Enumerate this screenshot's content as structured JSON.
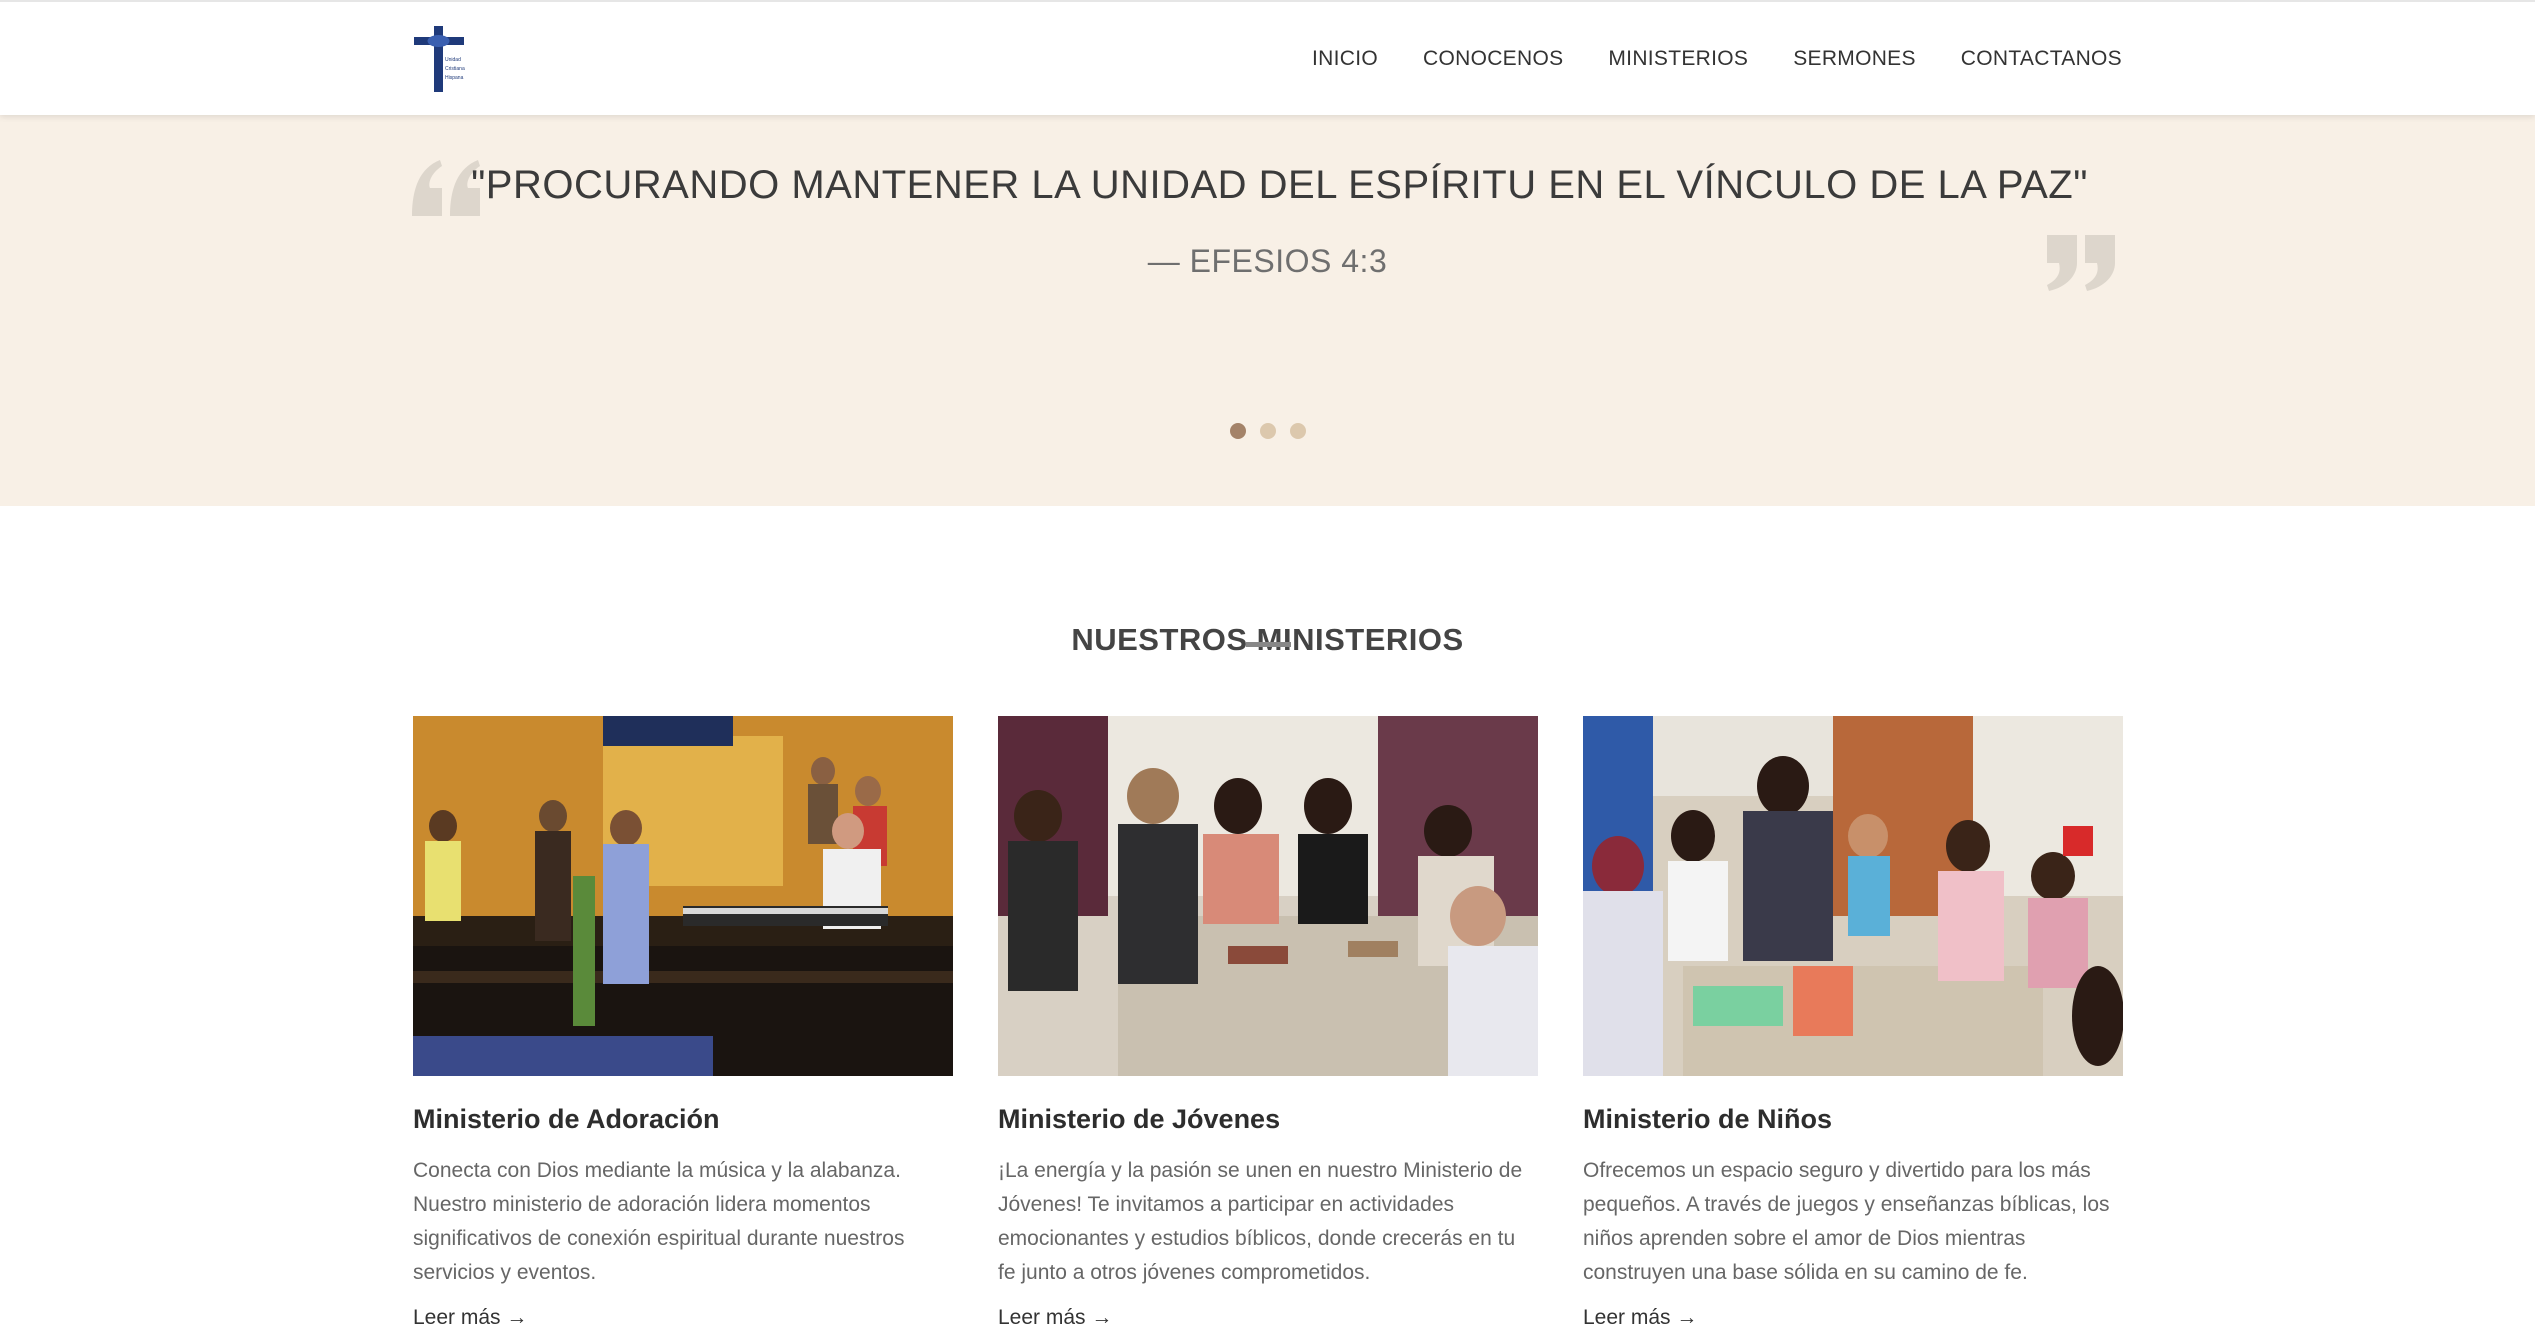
{
  "header": {
    "logo_text": [
      "Unidad",
      "Cristiana",
      "Hispana"
    ],
    "nav": [
      "INICIO",
      "CONOCENOS",
      "MINISTERIOS",
      "SERMONES",
      "CONTACTANOS"
    ]
  },
  "hero": {
    "quote": "\"PROCURANDO MANTENER LA UNIDAD DEL ESPÍRITU EN EL VÍNCULO DE LA PAZ\"",
    "source": "—  EFESIOS 4:3",
    "slides_total": 3,
    "slide_active": 1
  },
  "ministries": {
    "title": "NUESTROS MINISTERIOS",
    "cards": [
      {
        "photo": "worship-band-photo",
        "title": "Ministerio de Adoración",
        "text": "Conecta con Dios mediante la música y la alabanza. Nuestro ministerio de adoración lidera momentos significativos de conexión espiritual durante nuestros servicios y eventos.",
        "link": "Leer más →"
      },
      {
        "photo": "youth-group-photo",
        "title": "Ministerio de Jóvenes",
        "text": "¡La energía y la pasión se unen en nuestro Ministerio de Jóvenes! Te invitamos a participar en actividades emocionantes y estudios bíblicos, donde crecerás en tu fe junto a otros jóvenes comprometidos.",
        "link": "Leer más →"
      },
      {
        "photo": "children-class-photo",
        "title": "Ministerio de Niños",
        "text": "Ofrecemos un espacio seguro y divertido para los más pequeños. A través de juegos y enseñanzas bíblicas, los niños aprenden sobre el amor de Dios mientras construyen una base sólida en su camino de fe.",
        "link": "Leer más →"
      }
    ]
  },
  "colors": {
    "hero_bg": "#f8f0e6",
    "dot_active": "#a48369",
    "dot_inactive": "#dcc8ad",
    "logo_blue": "#1f3a7a"
  }
}
